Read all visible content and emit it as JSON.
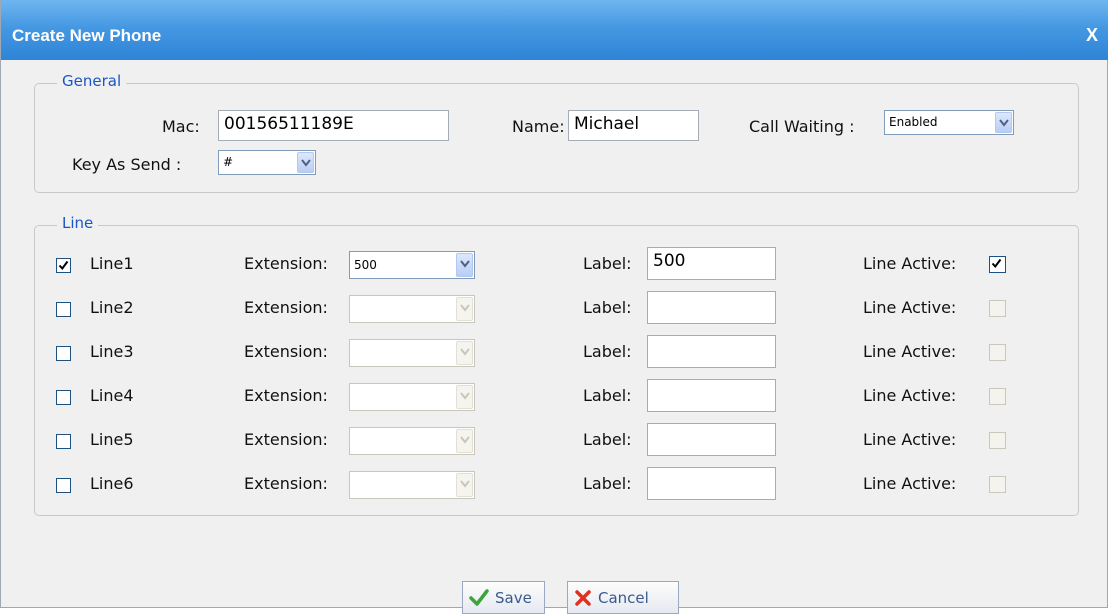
{
  "dialog": {
    "title": "Create New Phone",
    "close_label": "X"
  },
  "general": {
    "legend": "General",
    "mac_label": "Mac:",
    "mac_value": "00156511189E",
    "name_label": "Name:",
    "name_value": "Michael",
    "call_waiting_label": "Call Waiting :",
    "call_waiting_value": "Enabled",
    "key_as_send_label": "Key As Send :",
    "key_as_send_value": "#"
  },
  "line_section": {
    "legend": "Line",
    "extension_label": "Extension:",
    "label_label": "Label:",
    "line_active_label": "Line Active:",
    "lines": [
      {
        "name": "Line1",
        "checked": true,
        "extension": "500",
        "label": "500",
        "active": true,
        "enabled": true
      },
      {
        "name": "Line2",
        "checked": false,
        "extension": "",
        "label": "",
        "active": false,
        "enabled": false
      },
      {
        "name": "Line3",
        "checked": false,
        "extension": "",
        "label": "",
        "active": false,
        "enabled": false
      },
      {
        "name": "Line4",
        "checked": false,
        "extension": "",
        "label": "",
        "active": false,
        "enabled": false
      },
      {
        "name": "Line5",
        "checked": false,
        "extension": "",
        "label": "",
        "active": false,
        "enabled": false
      },
      {
        "name": "Line6",
        "checked": false,
        "extension": "",
        "label": "",
        "active": false,
        "enabled": false
      }
    ]
  },
  "buttons": {
    "save_label": "Save",
    "cancel_label": "Cancel"
  },
  "colors": {
    "title_bar": "#4598e2",
    "legend_text": "#1a55c8",
    "save_icon": "#3aa53a",
    "cancel_icon": "#e03020"
  }
}
